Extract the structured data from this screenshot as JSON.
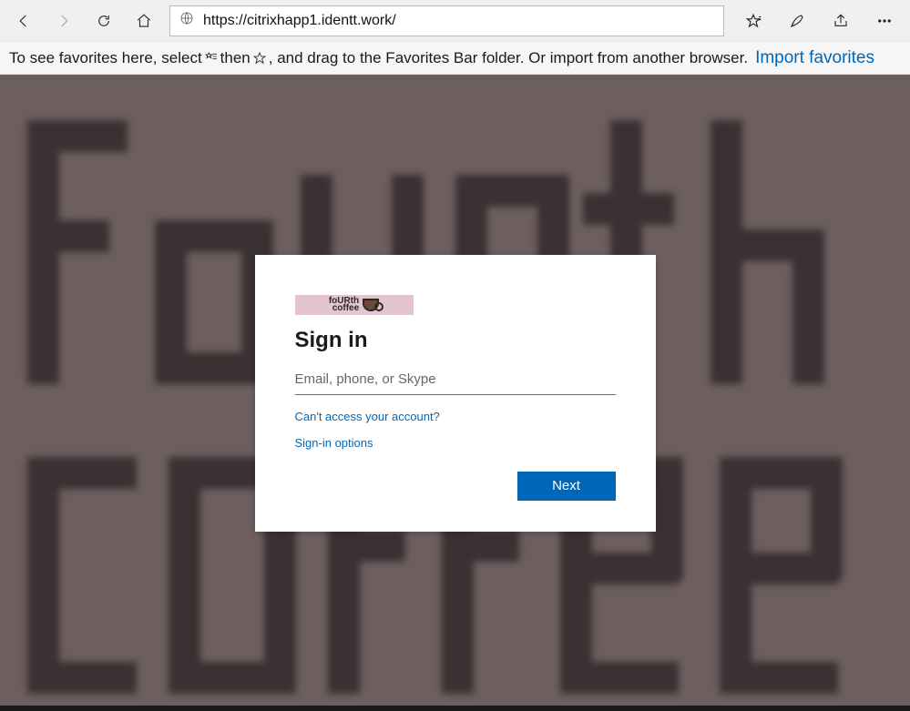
{
  "browser": {
    "url": "https://citrixhapp1.identt.work/"
  },
  "favbar": {
    "text_a": "To see favorites here, select",
    "text_b": "then",
    "text_c": ", and drag to the Favorites Bar folder. Or import from another browser.",
    "import_link": "Import favorites"
  },
  "login": {
    "brand_text": "foURth\ncoffee",
    "title": "Sign in",
    "placeholder": "Email, phone, or Skype",
    "cant_access": "Can't access your account?",
    "signin_options": "Sign-in options",
    "next": "Next"
  }
}
